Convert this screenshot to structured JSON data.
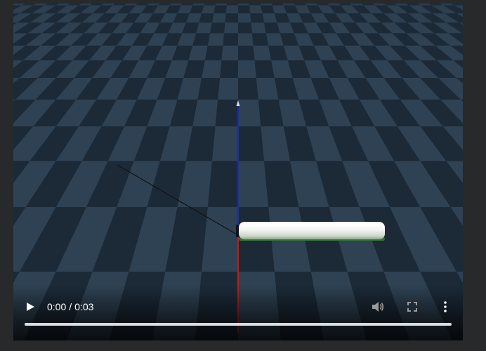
{
  "player": {
    "current_time": "0:00",
    "separator": "/",
    "duration": "0:03",
    "progress_fraction": 0,
    "icons": {
      "play": "play-icon",
      "volume": "volume-icon",
      "fullscreen": "fullscreen-icon",
      "menu": "more-options-icon"
    }
  },
  "colors": {
    "background": "#27292b",
    "floor_dark": "#1c2a38",
    "floor_light": "#2f4253",
    "axis_x": "#b22222",
    "axis_y": "#1f2d9a",
    "axis_z": "#111111",
    "object": "#f2f5f2",
    "object_edge": "#3d8f3d"
  }
}
